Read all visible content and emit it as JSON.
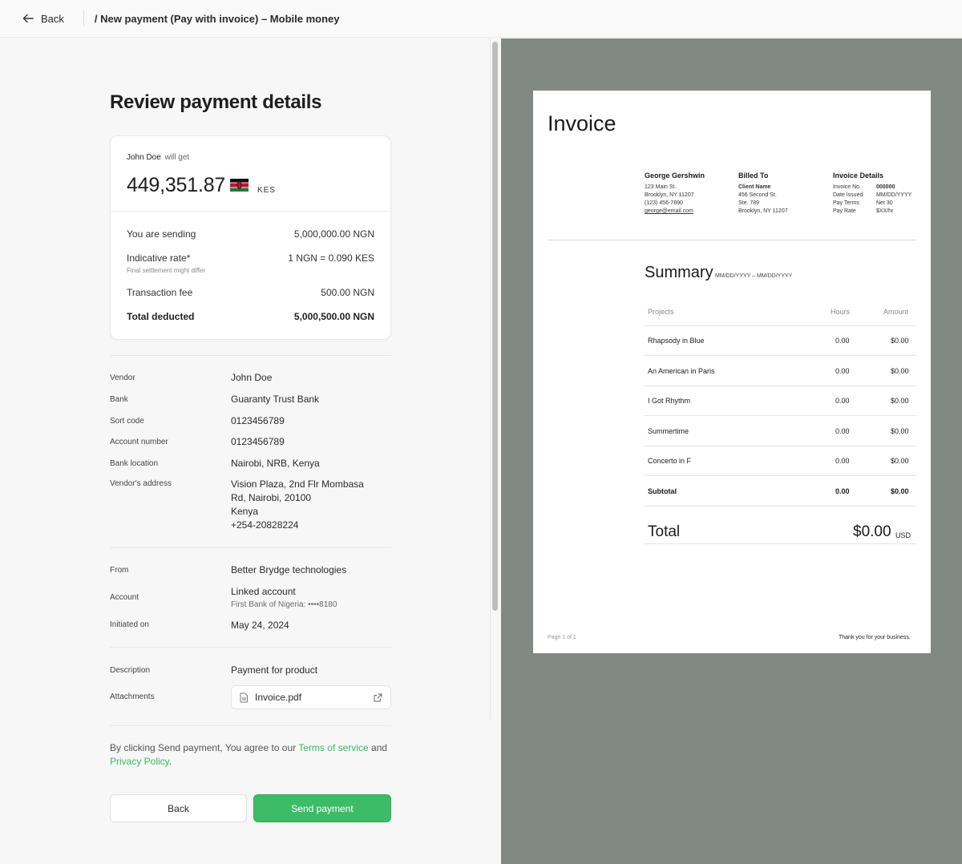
{
  "topbar": {
    "back_label": "Back",
    "breadcrumb": "/ New payment (Pay with invoice) – Mobile money"
  },
  "review": {
    "title": "Review payment details",
    "recipient_name": "John Doe",
    "recipient_suffix": "will get",
    "receive_amount": "449,351.87",
    "receive_currency": "KES",
    "flag": "kenya-flag-icon",
    "rows": {
      "sending_label": "You are sending",
      "sending_value": "5,000,000.00 NGN",
      "rate_label": "Indicative rate*",
      "rate_value": "1 NGN = 0.090 KES",
      "rate_note": "Final settlement might differ",
      "fee_label": "Transaction fee",
      "fee_value": "500.00 NGN",
      "total_label": "Total deducted",
      "total_value": "5,000,500.00 NGN"
    }
  },
  "vendor": {
    "vendor_label": "Vendor",
    "vendor_value": "John Doe",
    "bank_label": "Bank",
    "bank_value": "Guaranty Trust Bank",
    "sort_label": "Sort code",
    "sort_value": "0123456789",
    "account_label": "Account number",
    "account_value": "0123456789",
    "location_label": "Bank location",
    "location_value": "Nairobi, NRB, Kenya",
    "address_label": "Vendor's address",
    "address_line1": "Vision Plaza, 2nd Flr Mombasa",
    "address_line2": "Rd, Nairobi, 20100",
    "address_line3": "Kenya",
    "address_line4": "+254-20828224"
  },
  "source": {
    "from_label": "From",
    "from_value": "Better Brydge technologies",
    "account_label": "Account",
    "account_value": "Linked account",
    "account_sub": "First Bank of Nigeria:  ••••8180",
    "initiated_label": "Initiated on",
    "initiated_value": "May 24, 2024"
  },
  "extra": {
    "description_label": "Description",
    "description_value": "Payment for product",
    "attachments_label": "Attachments",
    "attachment_file": "Invoice.pdf"
  },
  "terms": {
    "prefix": "By clicking Send payment, You agree to our ",
    "tos": "Terms of service",
    "middle": " and ",
    "privacy": "Privacy Policy",
    "suffix": "."
  },
  "actions": {
    "back": "Back",
    "send": "Send payment"
  },
  "invoice": {
    "title": "Invoice",
    "from": {
      "name": "George Gershwin",
      "l1": "123 Main St.",
      "l2": "Brooklyn, NY 11207",
      "l3": "(123) 456-7890",
      "l4": "george@email.com"
    },
    "billed": {
      "heading": "Billed To",
      "l1": "Client Name",
      "l2": "456 Second St.",
      "l3": "Ste. 789",
      "l4": "Brooklyn, NY 11207"
    },
    "details": {
      "heading": "Invoice Details",
      "k1": "Invoice No.",
      "v1": "000000",
      "k2": "Date Issued",
      "v2": "MM/DD/YYYY",
      "k3": "Pay Terms",
      "v3": "Net 30",
      "k4": "Pay Rate",
      "v4": "$XX/hr"
    },
    "summary_title": "Summary",
    "summary_range": "MM/DD/YYYY – MM/DD/YYYY",
    "headers": {
      "projects": "Projects",
      "hours": "Hours",
      "amount": "Amount"
    },
    "items": [
      {
        "project": "Rhapsody in Blue",
        "hours": "0.00",
        "amount": "$0.00"
      },
      {
        "project": "An American in Paris",
        "hours": "0.00",
        "amount": "$0.00"
      },
      {
        "project": "I Got Rhythm",
        "hours": "0.00",
        "amount": "$0.00"
      },
      {
        "project": "Summertime",
        "hours": "0.00",
        "amount": "$0.00"
      },
      {
        "project": "Concerto in F",
        "hours": "0.00",
        "amount": "$0.00"
      }
    ],
    "subtotal": {
      "label": "Subtotal",
      "hours": "0.00",
      "amount": "$0.00"
    },
    "total_label": "Total",
    "total_value": "$0.00",
    "total_currency": "USD",
    "page_label": "Page 1 of 1",
    "thanks": "Thank you for your business."
  },
  "colors": {
    "accent": "#3dbb67",
    "preview_bg": "#828884"
  }
}
